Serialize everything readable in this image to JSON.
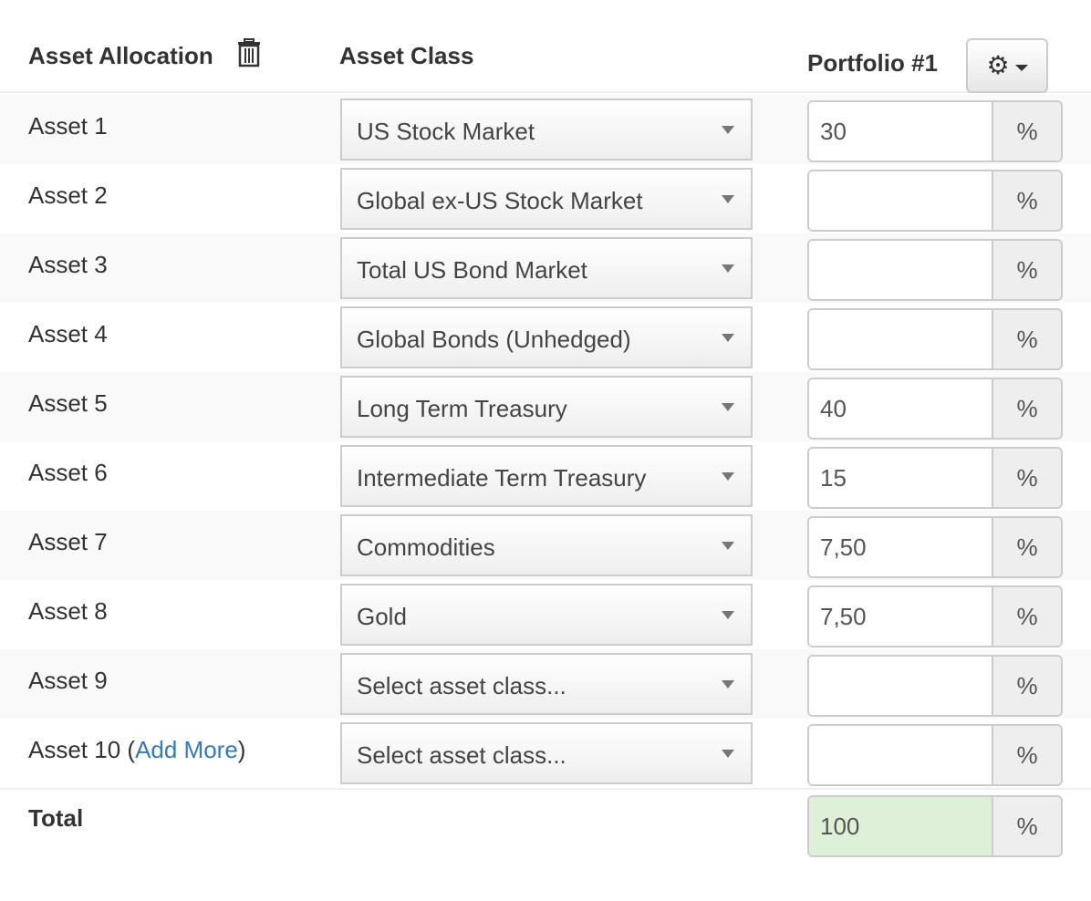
{
  "header": {
    "asset_allocation": "Asset Allocation",
    "asset_class": "Asset Class",
    "portfolio": "Portfolio #1",
    "trash_icon": "trash-icon",
    "settings_icon": "gear-icon"
  },
  "rows": [
    {
      "label": "Asset 1",
      "asset_class": "US Stock Market",
      "value": "30"
    },
    {
      "label": "Asset 2",
      "asset_class": "Global ex-US Stock Market",
      "value": ""
    },
    {
      "label": "Asset 3",
      "asset_class": "Total US Bond Market",
      "value": ""
    },
    {
      "label": "Asset 4",
      "asset_class": "Global Bonds (Unhedged)",
      "value": ""
    },
    {
      "label": "Asset 5",
      "asset_class": "Long Term Treasury",
      "value": "40"
    },
    {
      "label": "Asset 6",
      "asset_class": "Intermediate Term Treasury",
      "value": "15"
    },
    {
      "label": "Asset 7",
      "asset_class": "Commodities",
      "value": "7,50"
    },
    {
      "label": "Asset 8",
      "asset_class": "Gold",
      "value": "7,50"
    },
    {
      "label": "Asset 9",
      "asset_class": "Select asset class...",
      "value": ""
    },
    {
      "label": "Asset 10 (",
      "add_more": "Add More",
      "label_suffix": ")",
      "asset_class": "Select asset class...",
      "value": ""
    }
  ],
  "percent_symbol": "%",
  "total": {
    "label": "Total",
    "value": "100"
  },
  "colors": {
    "link": "#337ab7",
    "total_ok_bg": "#dff0d8",
    "stripe": "#f9f9f9"
  }
}
